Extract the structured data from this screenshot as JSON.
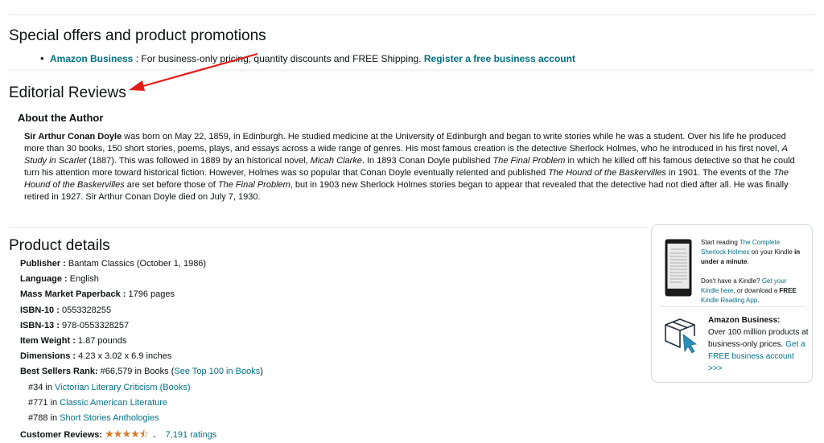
{
  "offers": {
    "title": "Special offers and product promotions",
    "item": {
      "brand": "Amazon Business",
      "text": " : For business-only pricing, quantity discounts and FREE Shipping. ",
      "link": "Register a free business account"
    }
  },
  "editorial": {
    "title": "Editorial Reviews",
    "about_heading": "About the Author",
    "author_name": "Sir Arthur Conan Doyle",
    "p1": " was born on May 22, 1859, in Edinburgh. He studied medicine at the University of Edinburgh and began to write stories while he was a student. Over his life he produced more than 30 books, 150 short stories, poems, plays, and essays across a wide range of genres. His most famous creation is the detective Sherlock Holmes, who he introduced in his first novel, ",
    "i1": "A Study in Scarlet",
    "p2": " (1887). This was followed in 1889 by an historical novel, ",
    "i2": "Micah Clarke",
    "p3": ". In 1893 Conan Doyle published ",
    "i3": "The Final Problem",
    "p4": " in which he killed off his famous detective so that he could turn his attention more toward historical fiction. However, Holmes was so popular that Conan Doyle eventually relented and published ",
    "i4": "The Hound of the Baskervilles",
    "p5": " in 1901. The events of the ",
    "i5": "The Hound of the Baskervilles",
    "p6": " are set before those of ",
    "i6": "The Final Problem",
    "p7": ", but in 1903 new Sherlock Holmes stories began to appear that revealed that the detective had not died after all. He was finally retired in 1927. Sir Arthur Conan Doyle died on July 7, 1930."
  },
  "details": {
    "title": "Product details",
    "publisher": {
      "label": "Publisher : ",
      "value": "Bantam Classics (October 1, 1986)"
    },
    "language": {
      "label": "Language : ",
      "value": "English"
    },
    "paperback": {
      "label": "Mass Market Paperback : ",
      "value": "1796 pages"
    },
    "isbn10": {
      "label": "ISBN-10 : ",
      "value": "0553328255"
    },
    "isbn13": {
      "label": "ISBN-13 : ",
      "value": "978-0553328257"
    },
    "weight": {
      "label": "Item Weight : ",
      "value": "1.87 pounds"
    },
    "dimensions": {
      "label": "Dimensions : ",
      "value": "4.23 x 3.02 x 6.9 inches"
    },
    "rank": {
      "label": "Best Sellers Rank: ",
      "value": "#66,579 in Books (",
      "top_link": "See Top 100 in Books",
      "close": ")",
      "sub": [
        {
          "rank": "#34 in ",
          "category": "Victorian Literary Criticism (Books)"
        },
        {
          "rank": "#771 in ",
          "category": "Classic American Literature"
        },
        {
          "rank": "#788 in ",
          "category": "Short Stories Anthologies"
        }
      ]
    },
    "reviews": {
      "label": "Customer Reviews: ",
      "stars_glyph": "★★★★⯪",
      "rating": 4.7,
      "chevron": "⌄",
      "ratings_text": "7,191 ratings"
    }
  },
  "sidebox": {
    "kindle": {
      "start": "Start reading ",
      "title_link": "The Complete Sherlock Holmes",
      "on_kindle": " on your Kindle ",
      "minute": "in under a minute",
      "period": ".",
      "no_kindle": "Don't have a Kindle? ",
      "get_link": "Get your Kindle here",
      "or_download": ", or download a ",
      "free": "FREE",
      "app_link": "Kindle Reading App",
      "end": "."
    },
    "business": {
      "title": "Amazon Business:",
      "text": "Over 100 million products at business-only prices. ",
      "link": "Get a FREE business account >>>"
    }
  },
  "annotation": {
    "arrow_color": "#e31b17"
  },
  "colors": {
    "link": "#007185",
    "star": "#de7921",
    "text": "#0f1111"
  }
}
